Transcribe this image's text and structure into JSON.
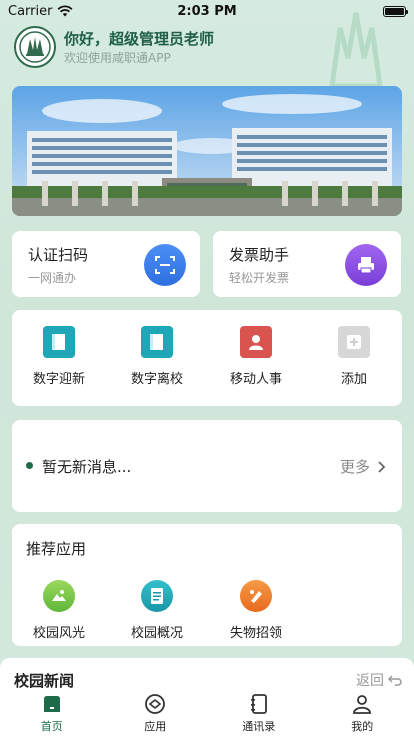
{
  "status_bar": {
    "carrier": "Carrier",
    "time": "2:03 PM"
  },
  "header": {
    "greeting": "你好，超级管理员老师",
    "subtitle": "欢迎使用咸职通APP"
  },
  "quick_actions": [
    {
      "title": "认证扫码",
      "subtitle": "一网通办",
      "icon": "scan-icon",
      "color": "#3d7df0"
    },
    {
      "title": "发票助手",
      "subtitle": "轻松开发票",
      "icon": "printer-icon",
      "color": "#8a4fe0"
    }
  ],
  "apps": [
    {
      "label": "数字迎新",
      "icon": "book-icon",
      "color": "#1fa7b7"
    },
    {
      "label": "数字离校",
      "icon": "book-icon",
      "color": "#1fa7b7"
    },
    {
      "label": "移动人事",
      "icon": "person-card-icon",
      "color": "#d9534f"
    },
    {
      "label": "添加",
      "icon": "plus-icon",
      "color": "#cfcfcf"
    }
  ],
  "message": {
    "text": "暂无新消息...",
    "more": "更多"
  },
  "recommended": {
    "title": "推荐应用",
    "items": [
      {
        "label": "校园风光",
        "icon": "landscape-icon",
        "color": "#7cc94a"
      },
      {
        "label": "校园概况",
        "icon": "document-icon",
        "color": "#1fa7b7"
      },
      {
        "label": "失物招领",
        "icon": "lost-found-icon",
        "color": "#f07d2f"
      }
    ]
  },
  "news": {
    "title": "校园新闻",
    "back": "返回"
  },
  "tabs": [
    {
      "label": "首页",
      "icon": "home-icon",
      "active": true
    },
    {
      "label": "应用",
      "icon": "apps-icon",
      "active": false
    },
    {
      "label": "通讯录",
      "icon": "contacts-icon",
      "active": false
    },
    {
      "label": "我的",
      "icon": "profile-icon",
      "active": false
    }
  ],
  "colors": {
    "brand": "#1e6b4a",
    "background": "#d6ebe0"
  }
}
